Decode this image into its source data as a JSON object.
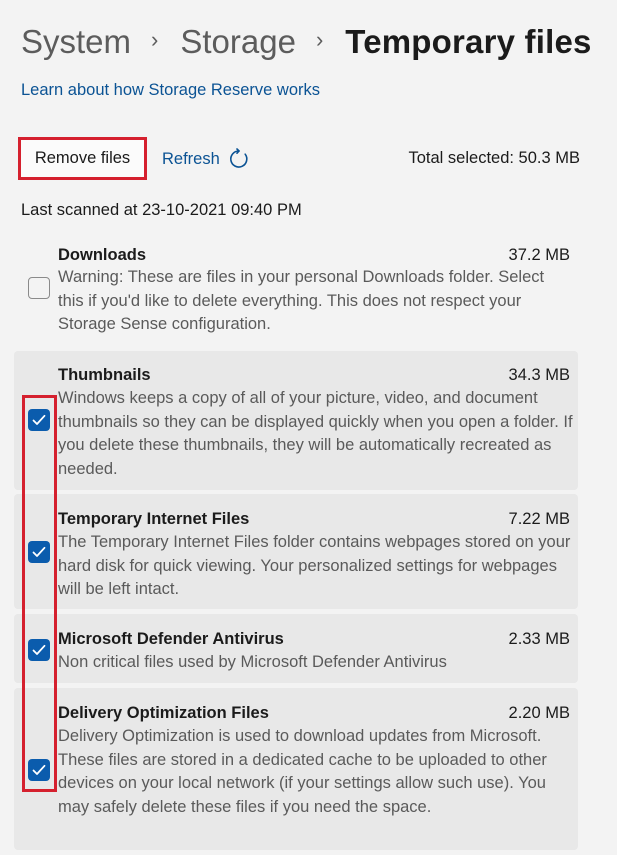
{
  "breadcrumb": {
    "items": [
      "System",
      "Storage"
    ],
    "current": "Temporary files",
    "separator": "›"
  },
  "learn_link": "Learn about how Storage Reserve works",
  "toolbar": {
    "remove_label": "Remove files",
    "refresh_label": "Refresh",
    "refresh_icon": "refresh-icon",
    "total_selected": "Total selected: 50.3 MB"
  },
  "last_scanned": "Last scanned at 23-10-2021 09:40 PM",
  "items": [
    {
      "title": "Downloads",
      "size": "37.2 MB",
      "description": "Warning: These are files in your personal Downloads folder. Select this if you'd like to delete everything. This does not respect your Storage Sense configuration.",
      "checked": false
    },
    {
      "title": "Thumbnails",
      "size": "34.3 MB",
      "description": "Windows keeps a copy of all of your picture, video, and document thumbnails so they can be displayed quickly when you open a folder. If you delete these thumbnails, they will be automatically recreated as needed.",
      "checked": true
    },
    {
      "title": "Temporary Internet Files",
      "size": "7.22 MB",
      "description": "The Temporary Internet Files folder contains webpages stored on your hard disk for quick viewing. Your personalized settings for webpages will be left intact.",
      "checked": true
    },
    {
      "title": "Microsoft Defender Antivirus",
      "size": "2.33 MB",
      "description": "Non critical files used by Microsoft Defender Antivirus",
      "checked": true
    },
    {
      "title": "Delivery Optimization Files",
      "size": "2.20 MB",
      "description": "Delivery Optimization is used to download updates from Microsoft. These files are stored in a dedicated cache to be uploaded to other devices on your local network (if your settings allow such use). You may safely delete these files if you need the space.",
      "checked": true
    }
  ],
  "colors": {
    "accent": "#0b5cad",
    "link": "#0b5394",
    "highlight": "#d5202e",
    "background": "#f3f3f3",
    "item_background": "#e8e8e8"
  }
}
